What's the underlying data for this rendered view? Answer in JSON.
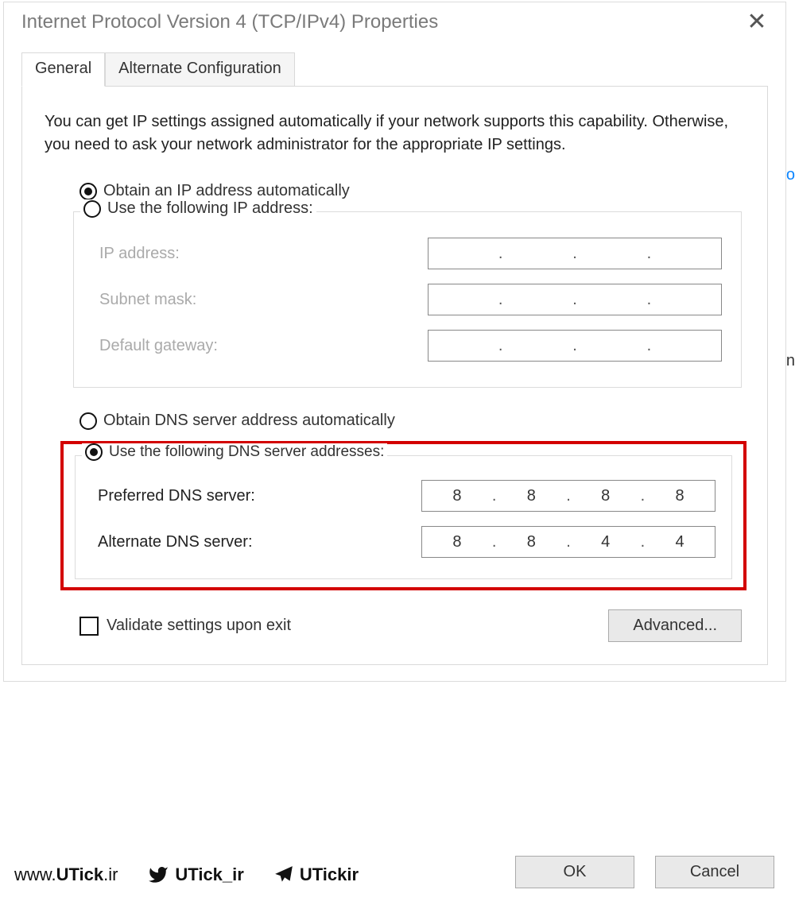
{
  "window": {
    "title": "Internet Protocol Version 4 (TCP/IPv4) Properties"
  },
  "tabs": {
    "general": "General",
    "alternate": "Alternate Configuration"
  },
  "intro": "You can get IP settings assigned automatically if your network supports this capability. Otherwise, you need to ask your network administrator for the appropriate IP settings.",
  "ip": {
    "radio_auto": "Obtain an IP address automatically",
    "radio_manual": "Use the following IP address:",
    "ip_address_label": "IP address:",
    "subnet_label": "Subnet mask:",
    "gateway_label": "Default gateway:"
  },
  "dns": {
    "radio_auto": "Obtain DNS server address automatically",
    "radio_manual": "Use the following DNS server addresses:",
    "preferred_label": "Preferred DNS server:",
    "alternate_label": "Alternate DNS server:",
    "preferred": {
      "o1": "8",
      "o2": "8",
      "o3": "8",
      "o4": "8"
    },
    "alternate": {
      "o1": "8",
      "o2": "8",
      "o3": "4",
      "o4": "4"
    }
  },
  "validate_label": "Validate settings upon exit",
  "buttons": {
    "advanced": "Advanced...",
    "ok": "OK",
    "cancel": "Cancel"
  },
  "watermark": {
    "site_prefix": "www.",
    "site_bold": "UTick",
    "site_suffix": ".ir",
    "twitter": "UTick_ir",
    "telegram": "UTickir"
  },
  "stray": {
    "o": "o",
    "m": "n"
  }
}
